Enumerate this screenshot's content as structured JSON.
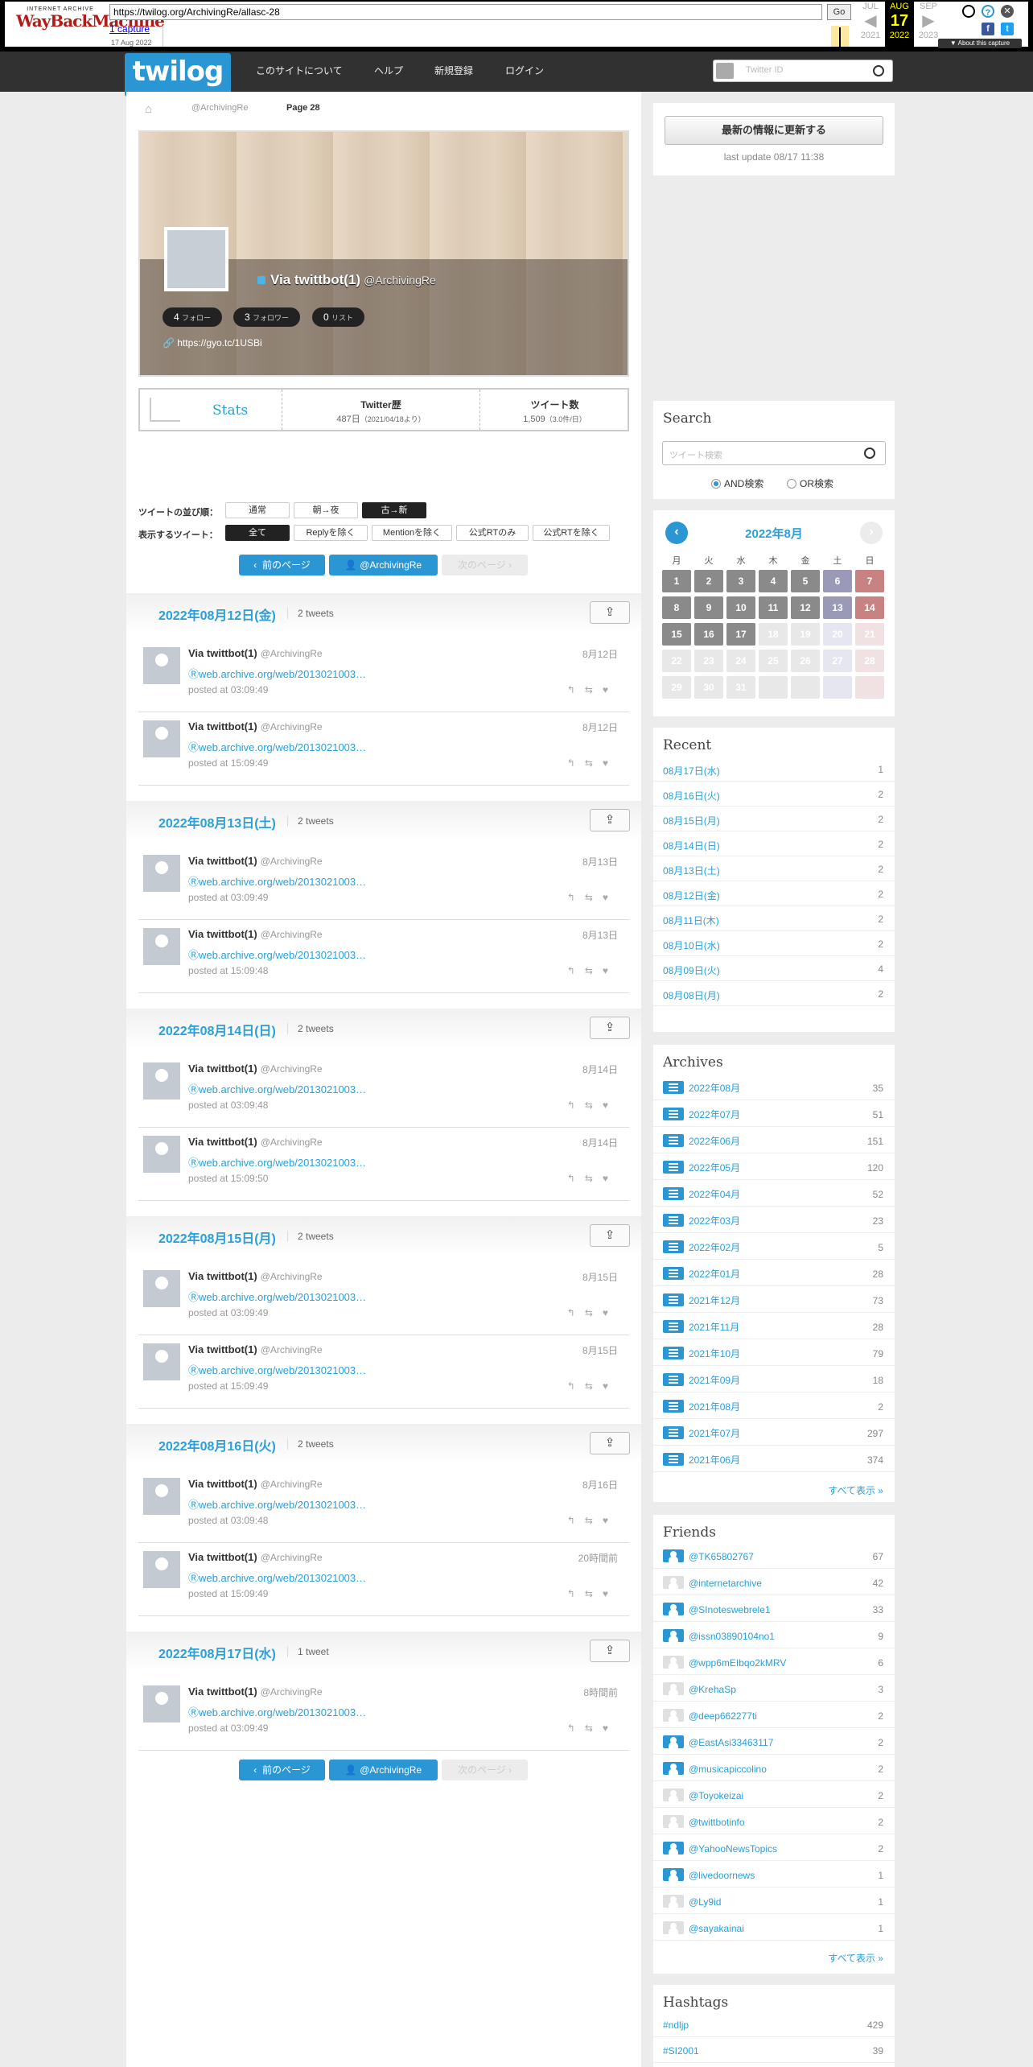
{
  "wayback": {
    "logo_line1": "INTERNET ARCHIVE",
    "logo_line2": "WayBackMachine",
    "url": "https://twilog.org/ArchivingRe/allasc-28",
    "go": "Go",
    "captures": "1 capture",
    "capture_date": "17 Aug 2022",
    "months": [
      {
        "m": "JUL",
        "d": "",
        "y": "2021"
      },
      {
        "m": "AUG",
        "d": "17",
        "y": "2022"
      },
      {
        "m": "SEP",
        "d": "",
        "y": "2023"
      }
    ],
    "about": "▼ About this capture"
  },
  "header": {
    "logo": "twilog",
    "nav": [
      "このサイトについて",
      "ヘルプ",
      "新規登録",
      "ログイン"
    ],
    "search_placeholder": "Twitter ID"
  },
  "breadcrumb": [
    "@ArchivingRe",
    "Page 28"
  ],
  "profile": {
    "name": "Via twittbot(1)",
    "screen_name": "@ArchivingRe",
    "follow_count": "4",
    "follow_label": "フォロー",
    "follower_count": "3",
    "follower_label": "フォロワー",
    "list_count": "0",
    "list_label": "リスト",
    "link": "https://gyo.tc/1USBi"
  },
  "stats": {
    "label": "Stats",
    "history_title": "Twitter歴",
    "history_value": "487日",
    "history_sub": "（2021/04/18より）",
    "tweets_title": "ツイート数",
    "tweets_value": "1,509",
    "tweets_sub": "（3.0件/日）"
  },
  "options": {
    "sort_label": "ツイートの並び順：",
    "sort": [
      "通常",
      "朝→夜",
      "古→新"
    ],
    "filter_label": "表示するツイート：",
    "filter": [
      "全て",
      "Replyを除く",
      "Mentionを除く",
      "公式RTのみ",
      "公式RTを除く"
    ]
  },
  "pager": {
    "prev": "前のページ",
    "user": "@ArchivingRe",
    "next": "次のページ"
  },
  "days": [
    {
      "date": "2022年08月12日(金)",
      "count": "2 tweets",
      "tweets": [
        {
          "date": "8月12日",
          "text": "Ⓡweb.archive.org/web/2013021003…",
          "posted": "posted at 03:09:49"
        },
        {
          "date": "8月12日",
          "text": "Ⓡweb.archive.org/web/2013021003…",
          "posted": "posted at 15:09:49"
        }
      ]
    },
    {
      "date": "2022年08月13日(土)",
      "count": "2 tweets",
      "tweets": [
        {
          "date": "8月13日",
          "text": "Ⓡweb.archive.org/web/2013021003…",
          "posted": "posted at 03:09:49"
        },
        {
          "date": "8月13日",
          "text": "Ⓡweb.archive.org/web/2013021003…",
          "posted": "posted at 15:09:48"
        }
      ]
    },
    {
      "date": "2022年08月14日(日)",
      "count": "2 tweets",
      "tweets": [
        {
          "date": "8月14日",
          "text": "Ⓡweb.archive.org/web/2013021003…",
          "posted": "posted at 03:09:48"
        },
        {
          "date": "8月14日",
          "text": "Ⓡweb.archive.org/web/2013021003…",
          "posted": "posted at 15:09:50"
        }
      ]
    },
    {
      "date": "2022年08月15日(月)",
      "count": "2 tweets",
      "tweets": [
        {
          "date": "8月15日",
          "text": "Ⓡweb.archive.org/web/2013021003…",
          "posted": "posted at 03:09:49"
        },
        {
          "date": "8月15日",
          "text": "Ⓡweb.archive.org/web/2013021003…",
          "posted": "posted at 15:09:49"
        }
      ]
    },
    {
      "date": "2022年08月16日(火)",
      "count": "2 tweets",
      "tweets": [
        {
          "date": "8月16日",
          "text": "Ⓡweb.archive.org/web/2013021003…",
          "posted": "posted at 03:09:48"
        },
        {
          "date": "20時間前",
          "text": "Ⓡweb.archive.org/web/2013021003…",
          "posted": "posted at 15:09:49"
        }
      ]
    },
    {
      "date": "2022年08月17日(水)",
      "count": "1 tweet",
      "tweets": [
        {
          "date": "8時間前",
          "text": "Ⓡweb.archive.org/web/2013021003…",
          "posted": "posted at 03:09:49"
        }
      ]
    }
  ],
  "tweet_author": {
    "name": "Via twittbot(1)",
    "screen_name": "@ArchivingRe"
  },
  "sidebar": {
    "update_button": "最新の情報に更新する",
    "last_update": "last update 08/17 11:38",
    "search_title": "Search",
    "search_placeholder": "ツイート検索",
    "and_label": "AND検索",
    "or_label": "OR検索",
    "calendar_title": "2022年8月",
    "dow": [
      "月",
      "火",
      "水",
      "木",
      "金",
      "土",
      "日"
    ],
    "recent_title": "Recent",
    "recent": [
      {
        "d": "08月17日(水)",
        "n": "1"
      },
      {
        "d": "08月16日(火)",
        "n": "2"
      },
      {
        "d": "08月15日(月)",
        "n": "2"
      },
      {
        "d": "08月14日(日)",
        "n": "2"
      },
      {
        "d": "08月13日(土)",
        "n": "2"
      },
      {
        "d": "08月12日(金)",
        "n": "2"
      },
      {
        "d": "08月11日(木)",
        "n": "2"
      },
      {
        "d": "08月10日(水)",
        "n": "2"
      },
      {
        "d": "08月09日(火)",
        "n": "4"
      },
      {
        "d": "08月08日(月)",
        "n": "2"
      }
    ],
    "archives_title": "Archives",
    "archives": [
      {
        "m": "2022年08月",
        "n": "35"
      },
      {
        "m": "2022年07月",
        "n": "51"
      },
      {
        "m": "2022年06月",
        "n": "151"
      },
      {
        "m": "2022年05月",
        "n": "120"
      },
      {
        "m": "2022年04月",
        "n": "52"
      },
      {
        "m": "2022年03月",
        "n": "23"
      },
      {
        "m": "2022年02月",
        "n": "5"
      },
      {
        "m": "2022年01月",
        "n": "28"
      },
      {
        "m": "2021年12月",
        "n": "73"
      },
      {
        "m": "2021年11月",
        "n": "28"
      },
      {
        "m": "2021年10月",
        "n": "79"
      },
      {
        "m": "2021年09月",
        "n": "18"
      },
      {
        "m": "2021年08月",
        "n": "2"
      },
      {
        "m": "2021年07月",
        "n": "297"
      },
      {
        "m": "2021年06月",
        "n": "374"
      }
    ],
    "show_all": "すべて表示 »",
    "friends_title": "Friends",
    "friends": [
      {
        "u": "@TK65802767",
        "n": "67",
        "on": true
      },
      {
        "u": "@internetarchive",
        "n": "42",
        "on": false
      },
      {
        "u": "@SInoteswebrele1",
        "n": "33",
        "on": true
      },
      {
        "u": "@issn03890104no1",
        "n": "9",
        "on": true
      },
      {
        "u": "@wpp6mEIbqo2kMRV",
        "n": "6",
        "on": false
      },
      {
        "u": "@KrehaSp",
        "n": "3",
        "on": false
      },
      {
        "u": "@deep662277ti",
        "n": "2",
        "on": false
      },
      {
        "u": "@EastAsi33463117",
        "n": "2",
        "on": true
      },
      {
        "u": "@musicapiccolino",
        "n": "2",
        "on": true
      },
      {
        "u": "@Toyokeizai",
        "n": "2",
        "on": false
      },
      {
        "u": "@twittbotinfo",
        "n": "2",
        "on": false
      },
      {
        "u": "@YahooNewsTopics",
        "n": "2",
        "on": true
      },
      {
        "u": "@livedoornews",
        "n": "1",
        "on": true
      },
      {
        "u": "@Ly9id",
        "n": "1",
        "on": false
      },
      {
        "u": "@sayakainai",
        "n": "1",
        "on": false
      }
    ],
    "hashtags_title": "Hashtags",
    "hashtags": [
      {
        "t": "#ndljp",
        "n": "429"
      },
      {
        "t": "#SI2001",
        "n": "39"
      }
    ]
  },
  "colors": {
    "accent": "#2a9fd8",
    "button": "#2a96d4",
    "header": "#313131"
  }
}
